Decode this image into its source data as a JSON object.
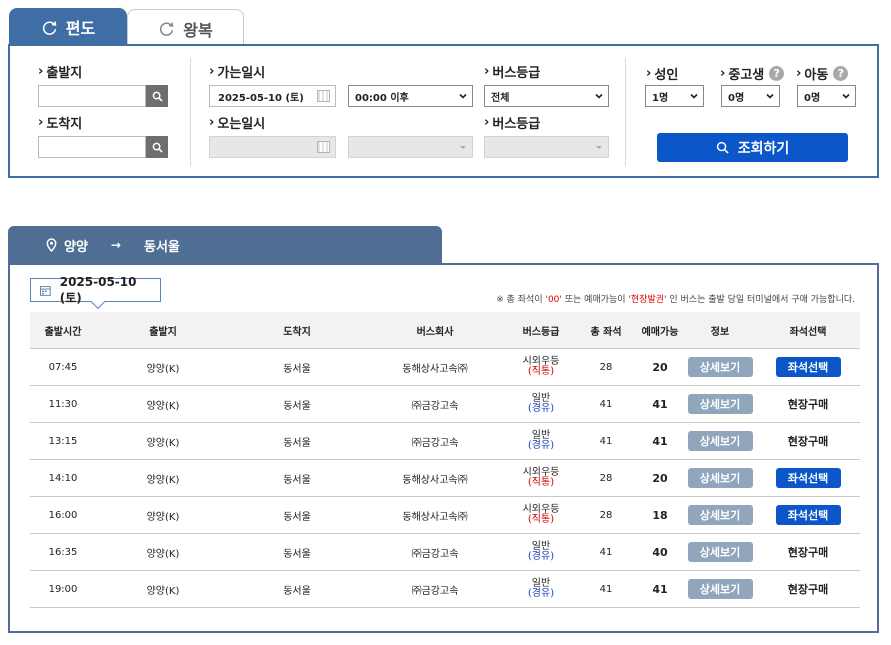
{
  "tabs": [
    {
      "label": "편도",
      "active": true,
      "icon": "refresh-icon"
    },
    {
      "label": "왕복",
      "active": false,
      "icon": "refresh-icon"
    }
  ],
  "search": {
    "departure_label": "출발지",
    "departure_value": "",
    "arrival_label": "도착지",
    "arrival_value": "",
    "go_date_label": "가는일시",
    "go_date_value": "2025-05-10 (토)",
    "go_time_value": "00:00 이후",
    "return_date_label": "오는일시",
    "return_date_value": "",
    "return_time_value": "",
    "grade_label_1": "버스등급",
    "grade_value_1": "전체",
    "grade_label_2": "버스등급",
    "grade_value_2": "",
    "adult_label": "성인",
    "adult_value": "1명",
    "student_label": "중고생",
    "student_value": "0명",
    "child_label": "아동",
    "child_value": "0명",
    "help_glyph": "?",
    "query_button": "조회하기"
  },
  "route": {
    "from": "양양",
    "to": "동서울",
    "arrow": "→"
  },
  "results": {
    "date": "2025-05-10 (토)",
    "notice_prefix": "※ 총 좌석이 '",
    "notice_zero": "00",
    "notice_mid": "' 또는 예매가능이 '",
    "notice_onsite": "현장발권",
    "notice_suffix": "' 인 버스는 출발 당일 터미널에서 구매 가능합니다.",
    "columns": [
      "출발시간",
      "출발지",
      "도착지",
      "버스회사",
      "버스등급",
      "총 좌석",
      "예매가능",
      "정보",
      "좌석선택"
    ],
    "rows": [
      {
        "time": "07:45",
        "from": "양양(K)",
        "to": "동서울",
        "company": "동해상사고속㈜",
        "grade": "시외우등",
        "grade_sub": "(직통)",
        "total": "28",
        "available": "20",
        "info": "상세보기",
        "seat": "좌석선택",
        "seat_type": "button"
      },
      {
        "time": "11:30",
        "from": "양양(K)",
        "to": "동서울",
        "company": "㈜금강고속",
        "grade": "일반",
        "grade_sub": "(경유)",
        "total": "41",
        "available": "41",
        "info": "상세보기",
        "seat": "현장구매",
        "seat_type": "text"
      },
      {
        "time": "13:15",
        "from": "양양(K)",
        "to": "동서울",
        "company": "㈜금강고속",
        "grade": "일반",
        "grade_sub": "(경유)",
        "total": "41",
        "available": "41",
        "info": "상세보기",
        "seat": "현장구매",
        "seat_type": "text"
      },
      {
        "time": "14:10",
        "from": "양양(K)",
        "to": "동서울",
        "company": "동해상사고속㈜",
        "grade": "시외우등",
        "grade_sub": "(직통)",
        "total": "28",
        "available": "20",
        "info": "상세보기",
        "seat": "좌석선택",
        "seat_type": "button"
      },
      {
        "time": "16:00",
        "from": "양양(K)",
        "to": "동서울",
        "company": "동해상사고속㈜",
        "grade": "시외우등",
        "grade_sub": "(직통)",
        "total": "28",
        "available": "18",
        "info": "상세보기",
        "seat": "좌석선택",
        "seat_type": "button"
      },
      {
        "time": "16:35",
        "from": "양양(K)",
        "to": "동서울",
        "company": "㈜금강고속",
        "grade": "일반",
        "grade_sub": "(경유)",
        "total": "41",
        "available": "40",
        "info": "상세보기",
        "seat": "현장구매",
        "seat_type": "text"
      },
      {
        "time": "19:00",
        "from": "양양(K)",
        "to": "동서울",
        "company": "㈜금강고속",
        "grade": "일반",
        "grade_sub": "(경유)",
        "total": "41",
        "available": "41",
        "info": "상세보기",
        "seat": "현장구매",
        "seat_type": "text"
      }
    ]
  },
  "colors": {
    "primary": "#3e6ea3",
    "route_header": "#4f6e94",
    "button_blue": "#0b57c9",
    "button_gray": "#8fa6bd",
    "express_red": "#d00000",
    "via_blue": "#1a3fbf"
  }
}
